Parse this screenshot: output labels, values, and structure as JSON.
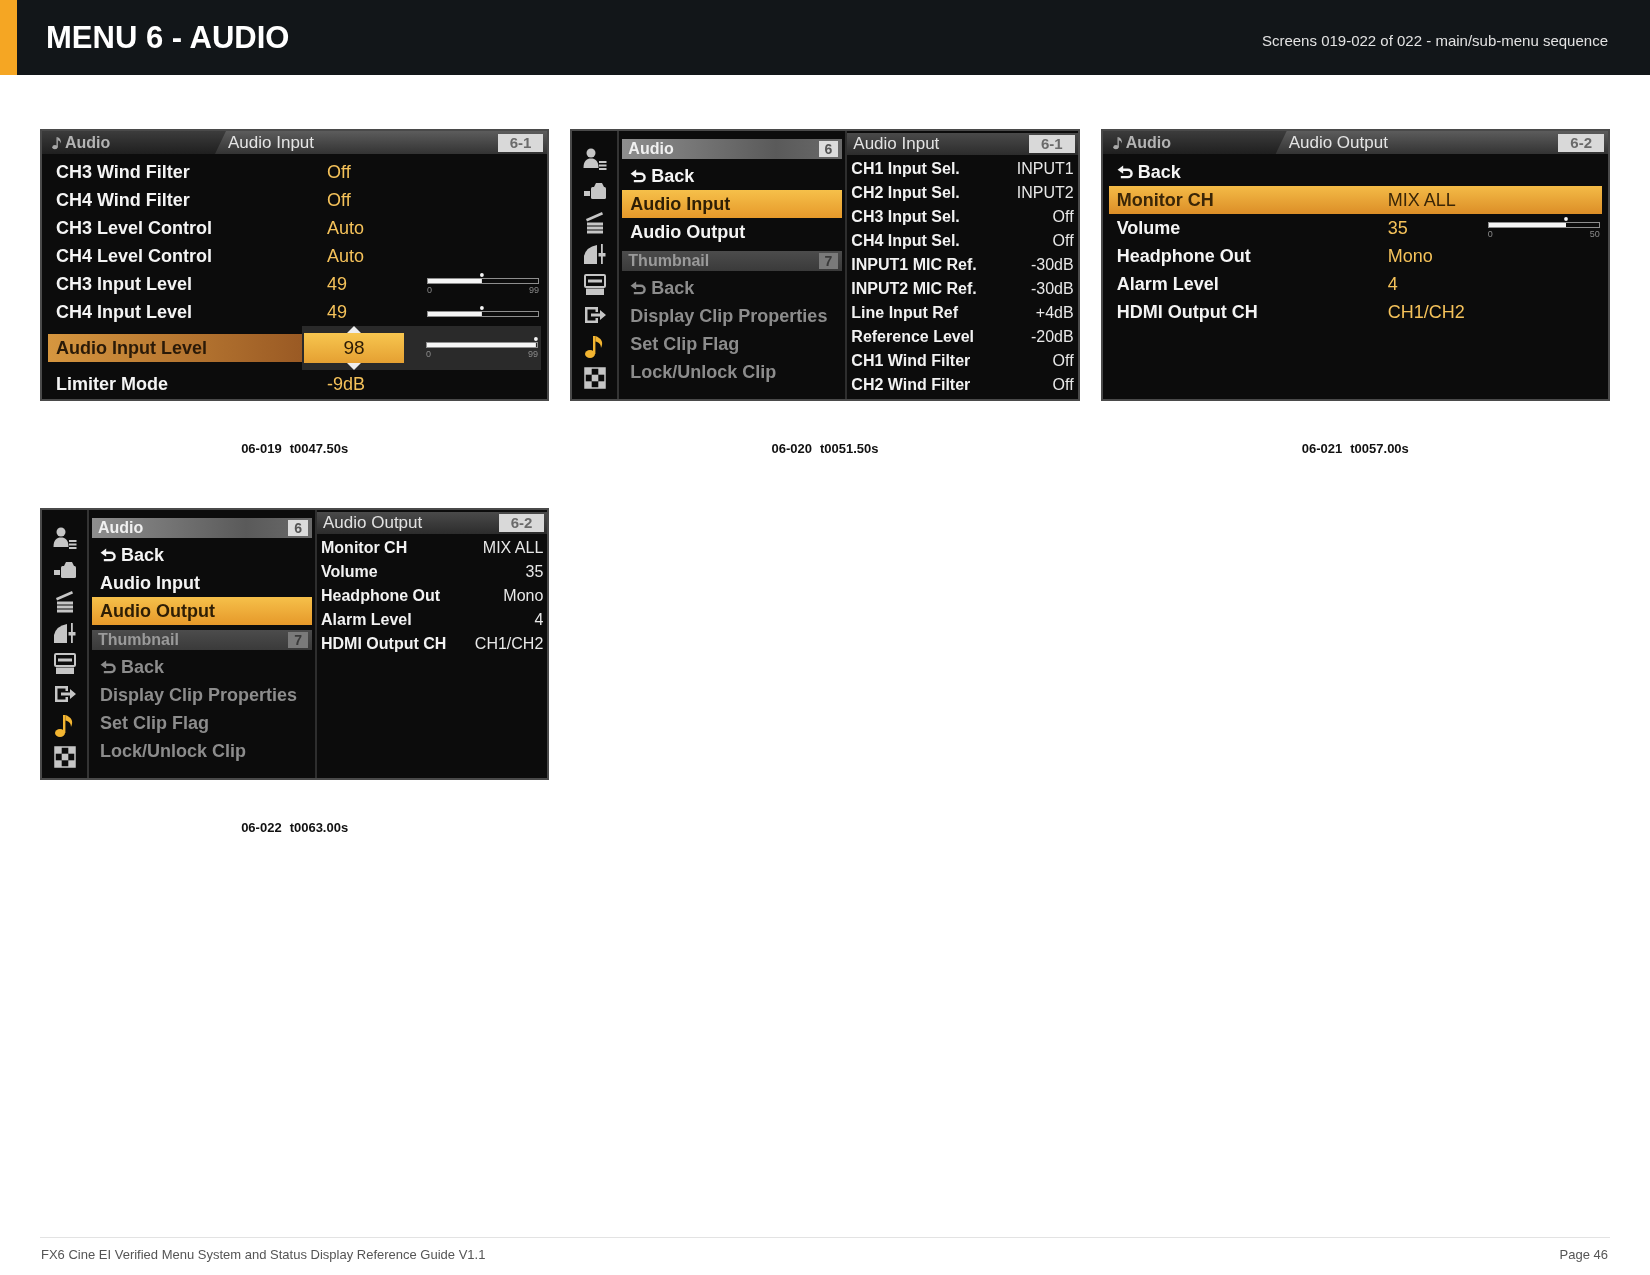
{
  "header": {
    "title": "MENU 6 - AUDIO",
    "subtitle": "Screens 019-022 of 022 - main/sub-menu sequence"
  },
  "screens": [
    {
      "kind": "detail",
      "breadcrumb": "Audio",
      "title": "Audio Input",
      "page": "6-1",
      "rows": [
        {
          "kind": "item",
          "label": "CH3 Wind Filter",
          "value": "Off",
          "selected": false
        },
        {
          "kind": "item",
          "label": "CH4 Wind Filter",
          "value": "Off",
          "selected": false
        },
        {
          "kind": "item",
          "label": "CH3 Level Control",
          "value": "Auto",
          "selected": false
        },
        {
          "kind": "item",
          "label": "CH4 Level Control",
          "value": "Auto",
          "selected": false
        },
        {
          "kind": "meter",
          "label": "CH3 Input Level",
          "value": "49",
          "level": 0.49,
          "min": "0",
          "max": "99",
          "selected": false
        },
        {
          "kind": "meter",
          "label": "CH4 Input Level",
          "value": "49",
          "level": 0.49,
          "selected": false
        },
        {
          "kind": "editing",
          "label": "Audio Input Level",
          "selected": true,
          "editor": {
            "value": "98",
            "level": 0.99,
            "min": "0",
            "max": "99"
          }
        },
        {
          "kind": "item",
          "label": "Limiter Mode",
          "value": "-9dB",
          "selected": false
        }
      ],
      "caption": {
        "code": "06-019",
        "time": "t0047.50s"
      }
    },
    {
      "kind": "split",
      "category_icons": [
        {
          "selected": false
        },
        {
          "selected": false
        },
        {
          "selected": false
        },
        {
          "selected": false
        },
        {
          "selected": false
        },
        {
          "selected": false
        },
        {
          "selected": true
        },
        {
          "selected": false
        }
      ],
      "sections": [
        {
          "title": "Audio",
          "number": "6",
          "dimmed": false,
          "items": [
            {
              "kind": "back",
              "label": "Back",
              "selected": false
            },
            {
              "kind": "item",
              "label": "Audio Input",
              "selected": true
            },
            {
              "kind": "item",
              "label": "Audio Output",
              "selected": false
            }
          ]
        },
        {
          "title": "Thumbnail",
          "number": "7",
          "dimmed": true,
          "items": [
            {
              "kind": "back",
              "label": "Back",
              "selected": false
            },
            {
              "kind": "item",
              "label": "Display Clip Properties",
              "selected": false
            },
            {
              "kind": "item",
              "label": "Set Clip Flag",
              "selected": false
            },
            {
              "kind": "item",
              "label": "Lock/Unlock Clip",
              "selected": false
            }
          ]
        }
      ],
      "pane": {
        "title": "Audio Input",
        "page": "6-1",
        "rows": [
          {
            "label": "CH1 Input Sel.",
            "value": "INPUT1"
          },
          {
            "label": "CH2 Input Sel.",
            "value": "INPUT2"
          },
          {
            "label": "CH3 Input Sel.",
            "value": "Off"
          },
          {
            "label": "CH4 Input Sel.",
            "value": "Off"
          },
          {
            "label": "INPUT1 MIC Ref.",
            "value": "-30dB"
          },
          {
            "label": "INPUT2 MIC Ref.",
            "value": "-30dB"
          },
          {
            "label": "Line Input Ref",
            "value": "+4dB"
          },
          {
            "label": "Reference Level",
            "value": "-20dB"
          },
          {
            "label": "CH1 Wind Filter",
            "value": "Off"
          },
          {
            "label": "CH2 Wind Filter",
            "value": "Off"
          }
        ]
      },
      "caption": {
        "code": "06-020",
        "time": "t0051.50s"
      }
    },
    {
      "kind": "detail",
      "breadcrumb": "Audio",
      "title": "Audio Output",
      "page": "6-2",
      "rows": [
        {
          "kind": "back",
          "label": "Back",
          "selected": false
        },
        {
          "kind": "item",
          "label": "Monitor CH",
          "value": "MIX ALL",
          "selected": true
        },
        {
          "kind": "meter",
          "label": "Volume",
          "value": "35",
          "level": 0.7,
          "min": "0",
          "max": "50",
          "selected": false
        },
        {
          "kind": "item",
          "label": "Headphone Out",
          "value": "Mono",
          "selected": false
        },
        {
          "kind": "item",
          "label": "Alarm Level",
          "value": "4",
          "selected": false
        },
        {
          "kind": "item",
          "label": "HDMI Output CH",
          "value": "CH1/CH2",
          "selected": false
        }
      ],
      "caption": {
        "code": "06-021",
        "time": "t0057.00s"
      }
    },
    {
      "kind": "split",
      "category_icons": [
        {
          "selected": false
        },
        {
          "selected": false
        },
        {
          "selected": false
        },
        {
          "selected": false
        },
        {
          "selected": false
        },
        {
          "selected": false
        },
        {
          "selected": true
        },
        {
          "selected": false
        }
      ],
      "sections": [
        {
          "title": "Audio",
          "number": "6",
          "dimmed": false,
          "items": [
            {
              "kind": "back",
              "label": "Back",
              "selected": false
            },
            {
              "kind": "item",
              "label": "Audio Input",
              "selected": false
            },
            {
              "kind": "item",
              "label": "Audio Output",
              "selected": true
            }
          ]
        },
        {
          "title": "Thumbnail",
          "number": "7",
          "dimmed": true,
          "items": [
            {
              "kind": "back",
              "label": "Back",
              "selected": false
            },
            {
              "kind": "item",
              "label": "Display Clip Properties",
              "selected": false
            },
            {
              "kind": "item",
              "label": "Set Clip Flag",
              "selected": false
            },
            {
              "kind": "item",
              "label": "Lock/Unlock Clip",
              "selected": false
            }
          ]
        }
      ],
      "pane": {
        "title": "Audio Output",
        "page": "6-2",
        "rows": [
          {
            "label": "Monitor CH",
            "value": "MIX ALL"
          },
          {
            "label": "Volume",
            "value": "35"
          },
          {
            "label": "Headphone Out",
            "value": "Mono"
          },
          {
            "label": "Alarm Level",
            "value": "4"
          },
          {
            "label": "HDMI Output CH",
            "value": "CH1/CH2"
          }
        ]
      },
      "caption": {
        "code": "06-022",
        "time": "t0063.00s"
      }
    }
  ],
  "footer": {
    "left": "FX6 Cine EI Verified Menu System and Status Display Reference Guide V1.1",
    "right": "Page 46"
  }
}
